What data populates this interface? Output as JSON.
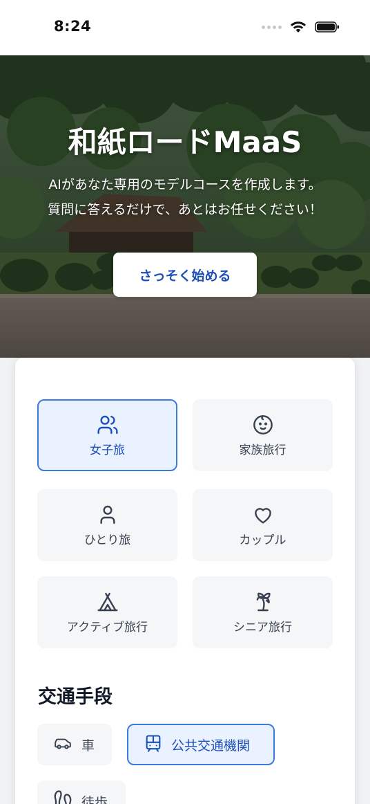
{
  "status_bar": {
    "time": "8:24"
  },
  "hero": {
    "title": "和紙ロードMaaS",
    "subtitle_line1": "AIがあなた専用のモデルコースを作成します。",
    "subtitle_line2": "質問に答えるだけで、あとはお任せください！",
    "cta_label": "さっそく始める"
  },
  "trip_types": [
    {
      "label": "女子旅",
      "icon": "users-icon",
      "selected": true
    },
    {
      "label": "家族旅行",
      "icon": "baby-face-icon",
      "selected": false
    },
    {
      "label": "ひとり旅",
      "icon": "user-icon",
      "selected": false
    },
    {
      "label": "カップル",
      "icon": "heart-icon",
      "selected": false
    },
    {
      "label": "アクティブ旅行",
      "icon": "tent-icon",
      "selected": false
    },
    {
      "label": "シニア旅行",
      "icon": "palm-tree-icon",
      "selected": false
    }
  ],
  "transport": {
    "title": "交通手段",
    "options": [
      {
        "label": "車",
        "icon": "car-icon",
        "selected": false
      },
      {
        "label": "公共交通機関",
        "icon": "train-icon",
        "selected": true
      },
      {
        "label": "徒歩",
        "icon": "footprints-icon",
        "selected": false
      }
    ]
  },
  "colors": {
    "accent": "#3b7be0",
    "accent_text": "#1d4fb8",
    "selected_bg": "#eaf2ff",
    "option_bg": "#f5f6f8"
  }
}
